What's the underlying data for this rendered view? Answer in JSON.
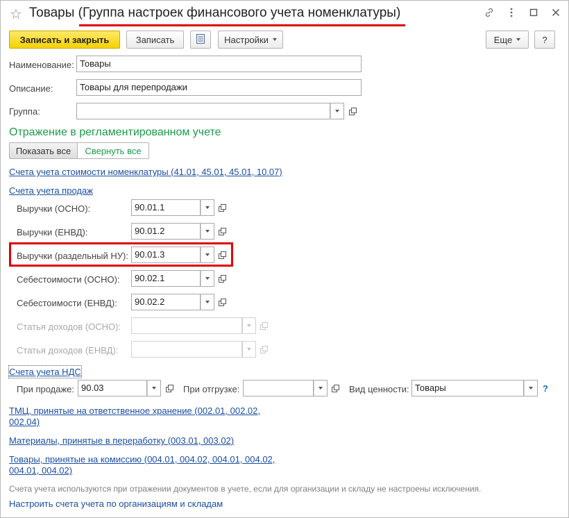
{
  "window": {
    "title": "Товары (Группа настроек финансового учета номенклатуры)",
    "icons": [
      "star-icon",
      "link-icon",
      "more-icon",
      "maximize-icon",
      "close-icon"
    ]
  },
  "toolbar": {
    "save_close": "Записать и закрыть",
    "save": "Записать",
    "settings": "Настройки",
    "more": "Еще",
    "help": "?"
  },
  "form": {
    "name_label": "Наименование:",
    "name_value": "Товары",
    "desc_label": "Описание:",
    "desc_value": "Товары для перепродажи",
    "group_label": "Группа:",
    "group_value": ""
  },
  "reg": {
    "title": "Отражение в регламентированном учете",
    "show_all": "Показать все",
    "collapse_all": "Свернуть все",
    "cost_link": "Счета учета стоимости номенклатуры (41.01, 45.01, 45.01, 10.07)",
    "sales_link": "Счета учета продаж"
  },
  "sales": [
    {
      "label": "Выручки (ОСНО):",
      "value": "90.01.1",
      "enabled": true
    },
    {
      "label": "Выручки (ЕНВД):",
      "value": "90.01.2",
      "enabled": true
    },
    {
      "label": "Выручки (раздельный НУ):",
      "value": "90.01.3",
      "enabled": true
    },
    {
      "label": "Себестоимости (ОСНО):",
      "value": "90.02.1",
      "enabled": true
    },
    {
      "label": "Себестоимости (ЕНВД):",
      "value": "90.02.2",
      "enabled": true
    },
    {
      "label": "Статья доходов (ОСНО):",
      "value": "",
      "enabled": false
    },
    {
      "label": "Статья доходов (ЕНВД):",
      "value": "",
      "enabled": false
    }
  ],
  "vat": {
    "link": "Счета учета НДС",
    "on_sale_label": "При продаже:",
    "on_sale_value": "90.03",
    "on_ship_label": "При отгрузке:",
    "on_ship_value": "",
    "value_type_label": "Вид ценности:",
    "value_type_value": "Товары",
    "help": "?"
  },
  "links": {
    "tmc_line1": "ТМЦ, принятые на ответственное хранение (002.01, 002.02,",
    "tmc_line2": "002.04)",
    "materials": "Материалы, принятые в переработку (003.01, 003.02)",
    "goods_line1": "Товары, принятые на комиссию (004.01, 004.02, 004.01, 004.02,",
    "goods_line2": "004.01, 004.02)",
    "setup": "Настроить счета учета по организациям и складам"
  },
  "footer": {
    "note": "Счета учета используются при отражении документов в учете, если для организации и складу не настроены исключения."
  },
  "colors": {
    "accent_green": "#1c9a4b",
    "link_blue": "#1a4ea2",
    "highlight_red": "#e00000",
    "primary_yellow": "#f5d200"
  }
}
